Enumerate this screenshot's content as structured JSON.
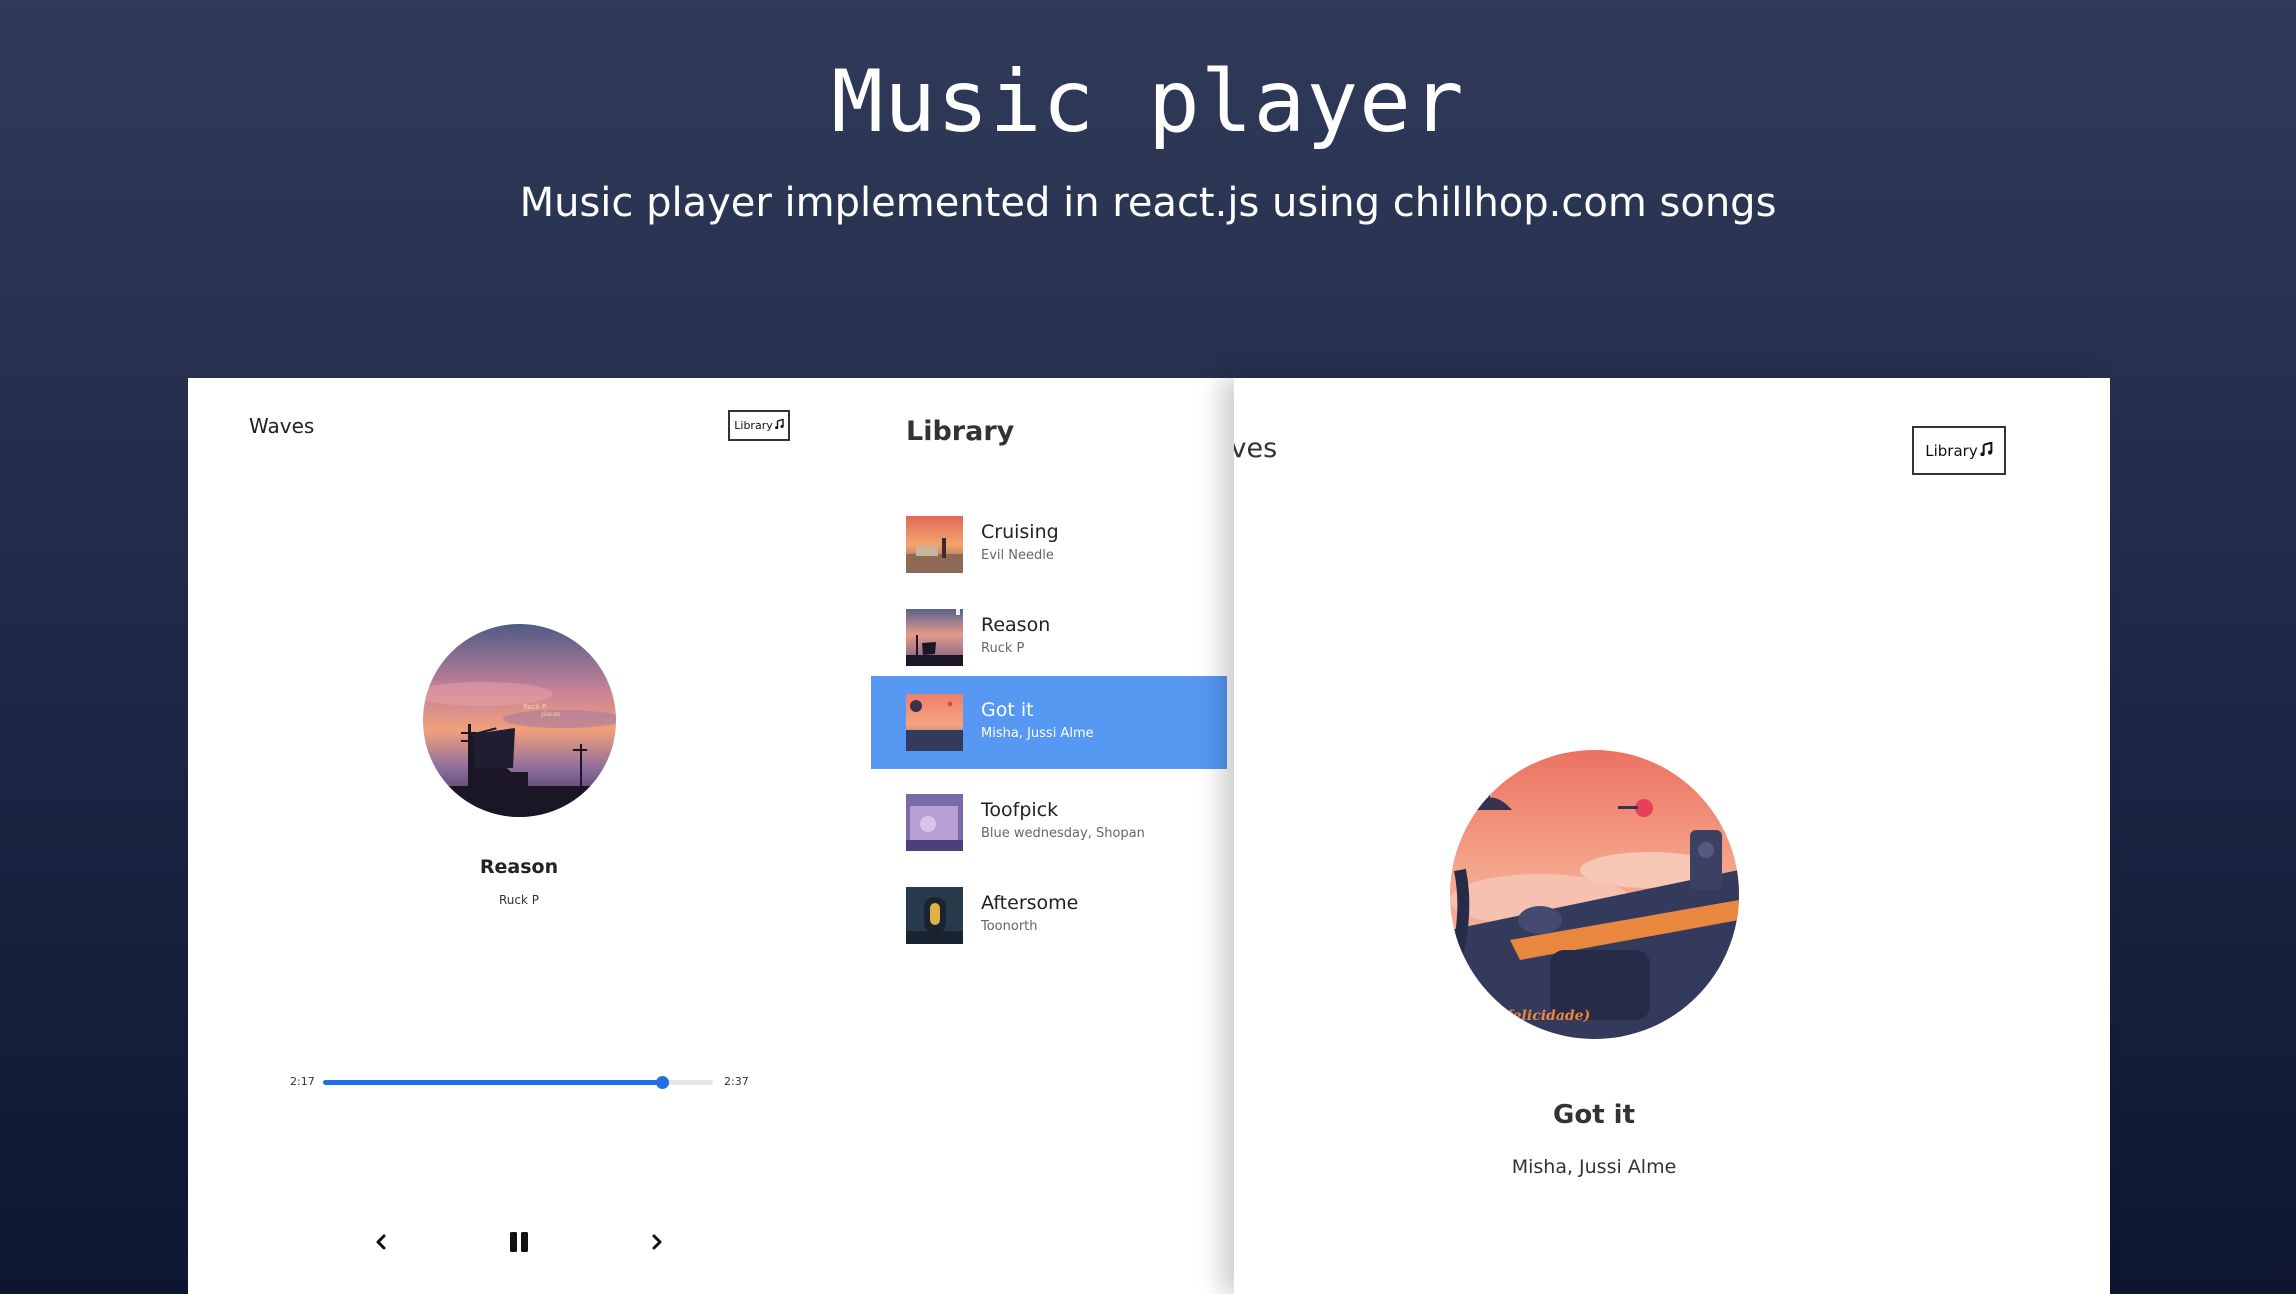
{
  "hero": {
    "title": "Music player",
    "subtitle": "Music player implemented in react.js using chillhop.com songs"
  },
  "left_player": {
    "nav_title": "Waves",
    "library_button_label": "Library",
    "library_button_icon": "music-note-icon",
    "song_title": "Reason",
    "song_artist": "Ruck P",
    "cover_text": "Ruck P places",
    "time_current": "2:17",
    "time_total": "2:37",
    "progress_fraction": 0.87,
    "accent_color": "#1f6fe0",
    "controls": {
      "prev_icon": "chevron-left-icon",
      "play_icon": "pause-icon",
      "next_icon": "chevron-right-icon"
    }
  },
  "library": {
    "heading": "Library",
    "selected_color": "#5698f2",
    "items": [
      {
        "name": "Cruising",
        "artist": "Evil Needle",
        "selected": false
      },
      {
        "name": "Reason",
        "artist": "Ruck P",
        "selected": false
      },
      {
        "name": "Got it",
        "artist": "Misha, Jussi Alme",
        "selected": true
      },
      {
        "name": "Toofpick",
        "artist": "Blue wednesday, Shopan",
        "selected": false
      },
      {
        "name": "Aftersome",
        "artist": "Toonorth",
        "selected": false
      }
    ]
  },
  "right_player": {
    "nav_title": "Waves",
    "library_button_label": "Library",
    "library_button_icon": "music-note-icon",
    "song_title": "Got it",
    "song_artist": "Misha, Jussi Alme",
    "cover_text": "(felicidade)"
  }
}
